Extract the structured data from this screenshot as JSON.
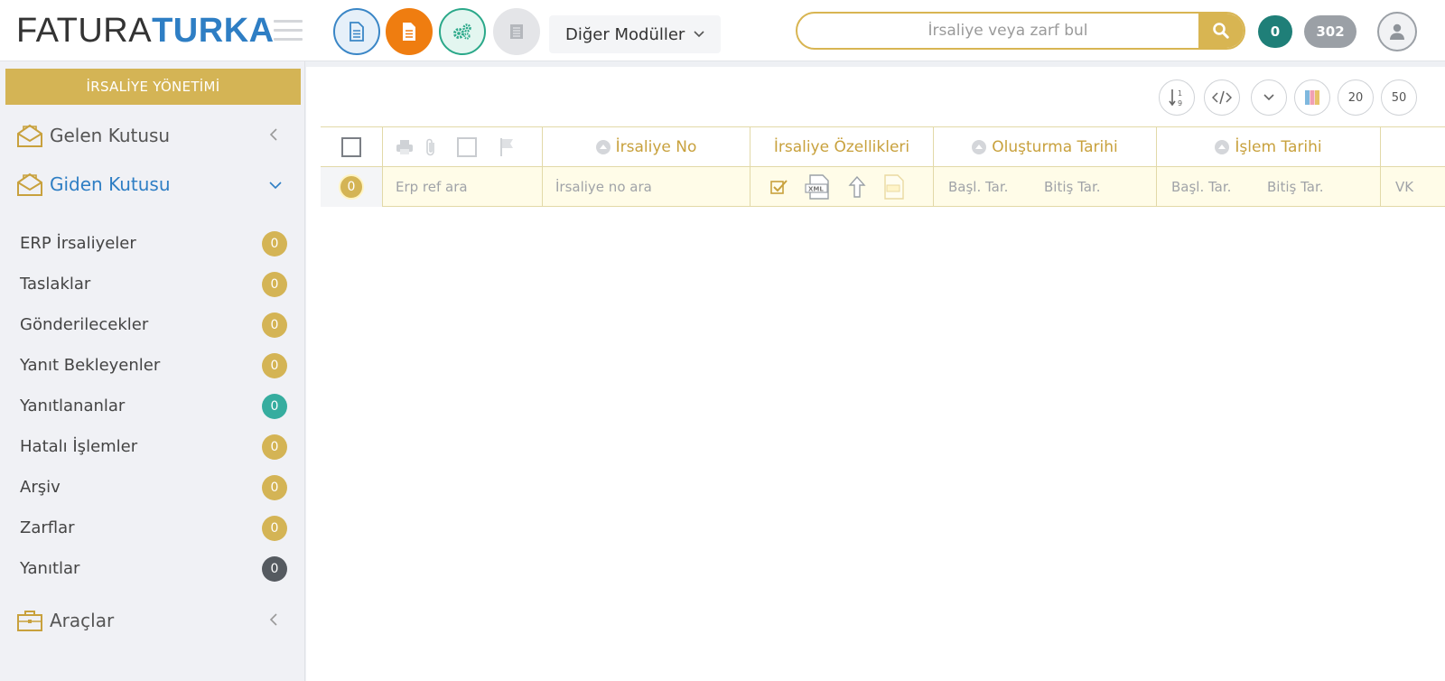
{
  "header": {
    "logo_part1": "FATURA",
    "logo_part2": "TURKA",
    "other_modules_label": "Diğer Modüller",
    "search_placeholder": "İrsaliye veya zarf bul",
    "badge_count_1": "0",
    "badge_count_2": "302"
  },
  "sidebar": {
    "title": "İRSALİYE YÖNETİMİ",
    "inbox_label": "Gelen Kutusu",
    "outbox_label": "Giden Kutusu",
    "tools_label": "Araçlar",
    "items": [
      {
        "label": "ERP İrsaliyeler",
        "count": "0",
        "color": "#d4b455"
      },
      {
        "label": "Taslaklar",
        "count": "0",
        "color": "#d4b455"
      },
      {
        "label": "Gönderilecekler",
        "count": "0",
        "color": "#d4b455"
      },
      {
        "label": "Yanıt Bekleyenler",
        "count": "0",
        "color": "#d4b455"
      },
      {
        "label": "Yanıtlananlar",
        "count": "0",
        "color": "#36ad9f"
      },
      {
        "label": "Hatalı İşlemler",
        "count": "0",
        "color": "#d4b455"
      },
      {
        "label": "Arşiv",
        "count": "0",
        "color": "#d4b455"
      },
      {
        "label": "Zarflar",
        "count": "0",
        "color": "#d4b455"
      },
      {
        "label": "Yanıtlar",
        "count": "0",
        "color": "#555a60"
      }
    ]
  },
  "toolbar": {
    "page_size_20": "20",
    "page_size_50": "50"
  },
  "grid": {
    "col_no": "İrsaliye No",
    "col_features": "İrsaliye Özellikleri",
    "col_created": "Oluşturma Tarihi",
    "col_processed": "İşlem Tarihi",
    "selected_count": "0",
    "erp_ref_placeholder": "Erp ref ara",
    "no_placeholder": "İrsaliye no ara",
    "created_start_placeholder": "Başl. Tar.",
    "created_end_placeholder": "Bitiş Tar.",
    "processed_start_placeholder": "Başl. Tar.",
    "processed_end_placeholder": "Bitiş Tar.",
    "vkn_placeholder": "VK"
  },
  "colors": {
    "brand_blue": "#2e7ec4",
    "gold": "#d4b455",
    "orange": "#ef7d10",
    "teal": "#1f7f78"
  }
}
